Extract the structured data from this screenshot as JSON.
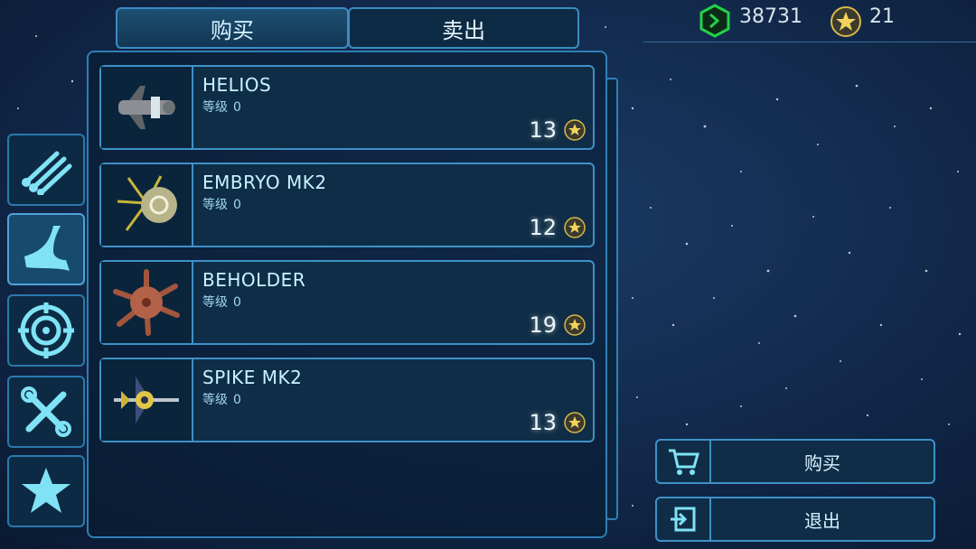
{
  "tabs": {
    "buy": "购买",
    "sell": "卖出"
  },
  "resources": {
    "credits": "38731",
    "stars": "21"
  },
  "categories": [
    {
      "icon": "weapons-icon"
    },
    {
      "icon": "drone-icon"
    },
    {
      "icon": "target-icon"
    },
    {
      "icon": "tools-icon"
    },
    {
      "icon": "star-icon"
    }
  ],
  "items": [
    {
      "name": "HELIOS",
      "level_label": "等级",
      "level": "0",
      "price": "13",
      "icon": "ship-helios-icon"
    },
    {
      "name": "EMBRYO MK2",
      "level_label": "等级",
      "level": "0",
      "price": "12",
      "icon": "ship-embryo-icon"
    },
    {
      "name": "BEHOLDER",
      "level_label": "等级",
      "level": "0",
      "price": "19",
      "icon": "ship-beholder-icon"
    },
    {
      "name": "SPIKE MK2",
      "level_label": "等级",
      "level": "0",
      "price": "13",
      "icon": "ship-spike-icon"
    }
  ],
  "actions": {
    "buy": "购买",
    "exit": "退出"
  },
  "colors": {
    "accent": "#3e91c8",
    "text": "#c9f3ff",
    "gem": "#22d14a",
    "gold": "#d8b84a"
  }
}
